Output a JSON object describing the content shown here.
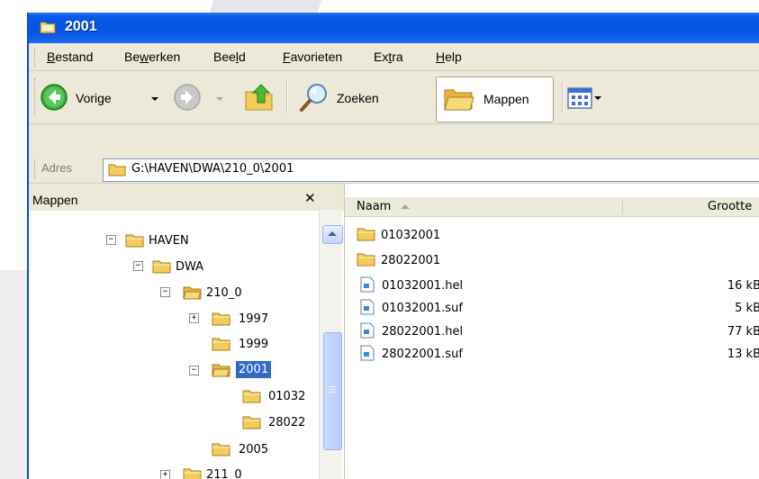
{
  "window": {
    "title": "2001"
  },
  "menubar": {
    "items": [
      {
        "label": "Bestand",
        "underline": "B"
      },
      {
        "label": "Bewerken",
        "underline": "w"
      },
      {
        "label": "Beeld",
        "underline": "l"
      },
      {
        "label": "Favorieten",
        "underline": "F"
      },
      {
        "label": "Extra",
        "underline": "t"
      },
      {
        "label": "Help",
        "underline": "H"
      }
    ]
  },
  "toolbar": {
    "back_label": "Vorige",
    "search_label": "Zoeken",
    "folders_label": "Mappen"
  },
  "address": {
    "label": "Adres",
    "value": "G:\\HAVEN\\DWA\\210_0\\2001"
  },
  "folder_pane": {
    "title": "Mappen",
    "close_glyph": "✕",
    "tree": [
      {
        "label": "HAVEN",
        "expander": "−"
      },
      {
        "label": "DWA",
        "expander": "−"
      },
      {
        "label": "210_0",
        "expander": "−"
      },
      {
        "label": "1997",
        "expander": "+"
      },
      {
        "label": "1999",
        "expander": ""
      },
      {
        "label": "2001",
        "expander": "−",
        "selected": true
      },
      {
        "label": "01032",
        "expander": ""
      },
      {
        "label": "28022",
        "expander": ""
      },
      {
        "label": "2005",
        "expander": ""
      },
      {
        "label": "211_0",
        "expander": "+"
      }
    ]
  },
  "file_list": {
    "columns": {
      "name": "Naam",
      "size": "Grootte"
    },
    "rows": [
      {
        "name": "01032001",
        "size": "",
        "type": "folder"
      },
      {
        "name": "28022001",
        "size": "",
        "type": "folder"
      },
      {
        "name": "01032001.hel",
        "size": "16 kB",
        "type": "file"
      },
      {
        "name": "01032001.suf",
        "size": "5 kB",
        "type": "file"
      },
      {
        "name": "28022001.hel",
        "size": "77 kB",
        "type": "file"
      },
      {
        "name": "28022001.suf",
        "size": "13 kB",
        "type": "file"
      }
    ]
  },
  "colors": {
    "titlebar": "#0554e3",
    "selection": "#316ac5",
    "chrome": "#ece9d8",
    "folder": "#f3cc5a"
  }
}
